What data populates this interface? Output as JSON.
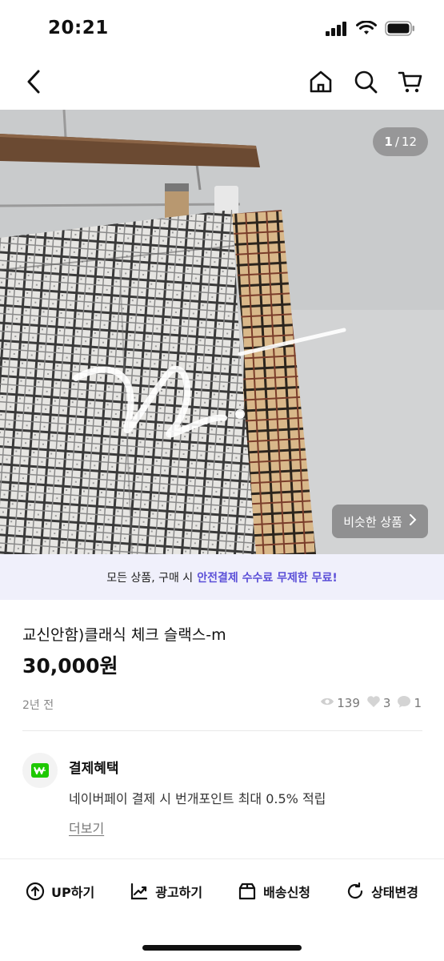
{
  "status_bar": {
    "time": "20:21",
    "icons": [
      "signal-icon",
      "wifi-icon",
      "battery-icon"
    ]
  },
  "nav": {
    "icons": [
      "back-icon",
      "home-icon",
      "search-icon",
      "cart-icon"
    ]
  },
  "gallery": {
    "current": "1",
    "separator": "/",
    "total": "12",
    "similar_label": "비슷한 상품"
  },
  "promo": {
    "prefix": "모든 상품, 구매 시",
    "highlight": "안전결제 수수료 무제한 무료!",
    "highlight_color": "#5b4fd8"
  },
  "product": {
    "title": "교신안함)클래식 체크 슬랙스-m",
    "price": "30,000원",
    "posted": "2년 전",
    "views": "139",
    "likes": "3",
    "chats": "1"
  },
  "benefit": {
    "title": "결제혜택",
    "description": "네이버페이 결제 시 번개포인트 최대 0.5% 적립",
    "more": "더보기",
    "brand_color": "#1ec800"
  },
  "actions": {
    "up": "UP하기",
    "ad": "광고하기",
    "shipping": "배송신청",
    "status": "상태변경"
  }
}
